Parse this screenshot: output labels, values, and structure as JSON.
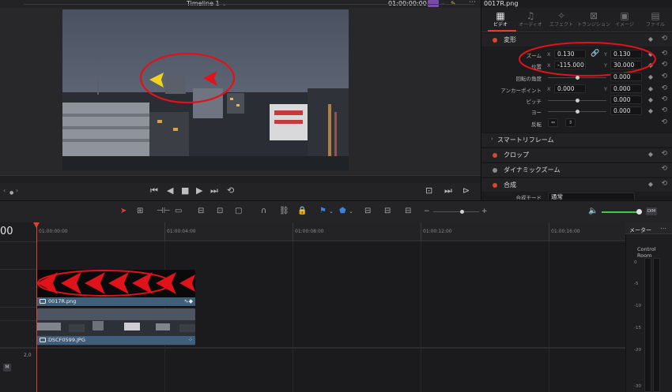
{
  "viewer": {
    "timeline_name": "Timeline 1",
    "timecode": "01:00:00:00"
  },
  "inspector": {
    "filename": "0017R.png",
    "tabs": [
      {
        "label": "ビデオ",
        "icon": "film-icon",
        "active": true
      },
      {
        "label": "オーディオ",
        "icon": "music-note-icon",
        "active": false
      },
      {
        "label": "エフェクト",
        "icon": "magic-wand-icon",
        "active": false
      },
      {
        "label": "トランジション",
        "icon": "transition-icon",
        "active": false
      },
      {
        "label": "イメージ",
        "icon": "image-icon",
        "active": false
      },
      {
        "label": "ファイル",
        "icon": "file-icon",
        "active": false
      }
    ],
    "transform": {
      "title": "変形",
      "zoom_label": "ズーム",
      "zoom_x": "0.130",
      "zoom_y": "0.130",
      "position_label": "位置",
      "position_x": "-115.000",
      "position_y": "30.000",
      "rotation_label": "回転の角度",
      "rotation": "0.000",
      "anchor_label": "アンカーポイント",
      "anchor_x": "0.000",
      "anchor_y": "0.000",
      "pitch_label": "ピッチ",
      "pitch": "0.000",
      "yaw_label": "ヨー",
      "yaw": "0.000",
      "flip_label": "反転",
      "x_label": "X",
      "y_label": "Y"
    },
    "sections": {
      "smart_reframe": "スマートリフレーム",
      "crop": "クロップ",
      "dynamic_zoom": "ダイナミックズーム",
      "composite": "合成",
      "composite_mode_label": "合成モード",
      "composite_mode_value": "通常"
    }
  },
  "timeline": {
    "timecode_display": "00",
    "ruler_ticks": [
      "01:00:00:00",
      "01:00:04:00",
      "01:00:08:00",
      "01:00:12:00",
      "01:00:16:00"
    ],
    "clips": [
      {
        "name": "0017R.png"
      },
      {
        "name": "DSCF0599.JPG"
      }
    ],
    "audio_level": "2,0",
    "mute_label": "M",
    "zoom_level_label": "DIM"
  },
  "meters": {
    "title": "メーター",
    "control_room": "Control Room",
    "scale": [
      "0",
      "-5",
      "-10",
      "-15",
      "-20",
      "-30"
    ]
  },
  "colors": {
    "accent_red": "#e4402f",
    "clip_blue": "#3f5e7a",
    "annotation_red": "#e0121a",
    "annotation_yellow": "#f1d31a",
    "volume_green": "#3ccf3c"
  }
}
